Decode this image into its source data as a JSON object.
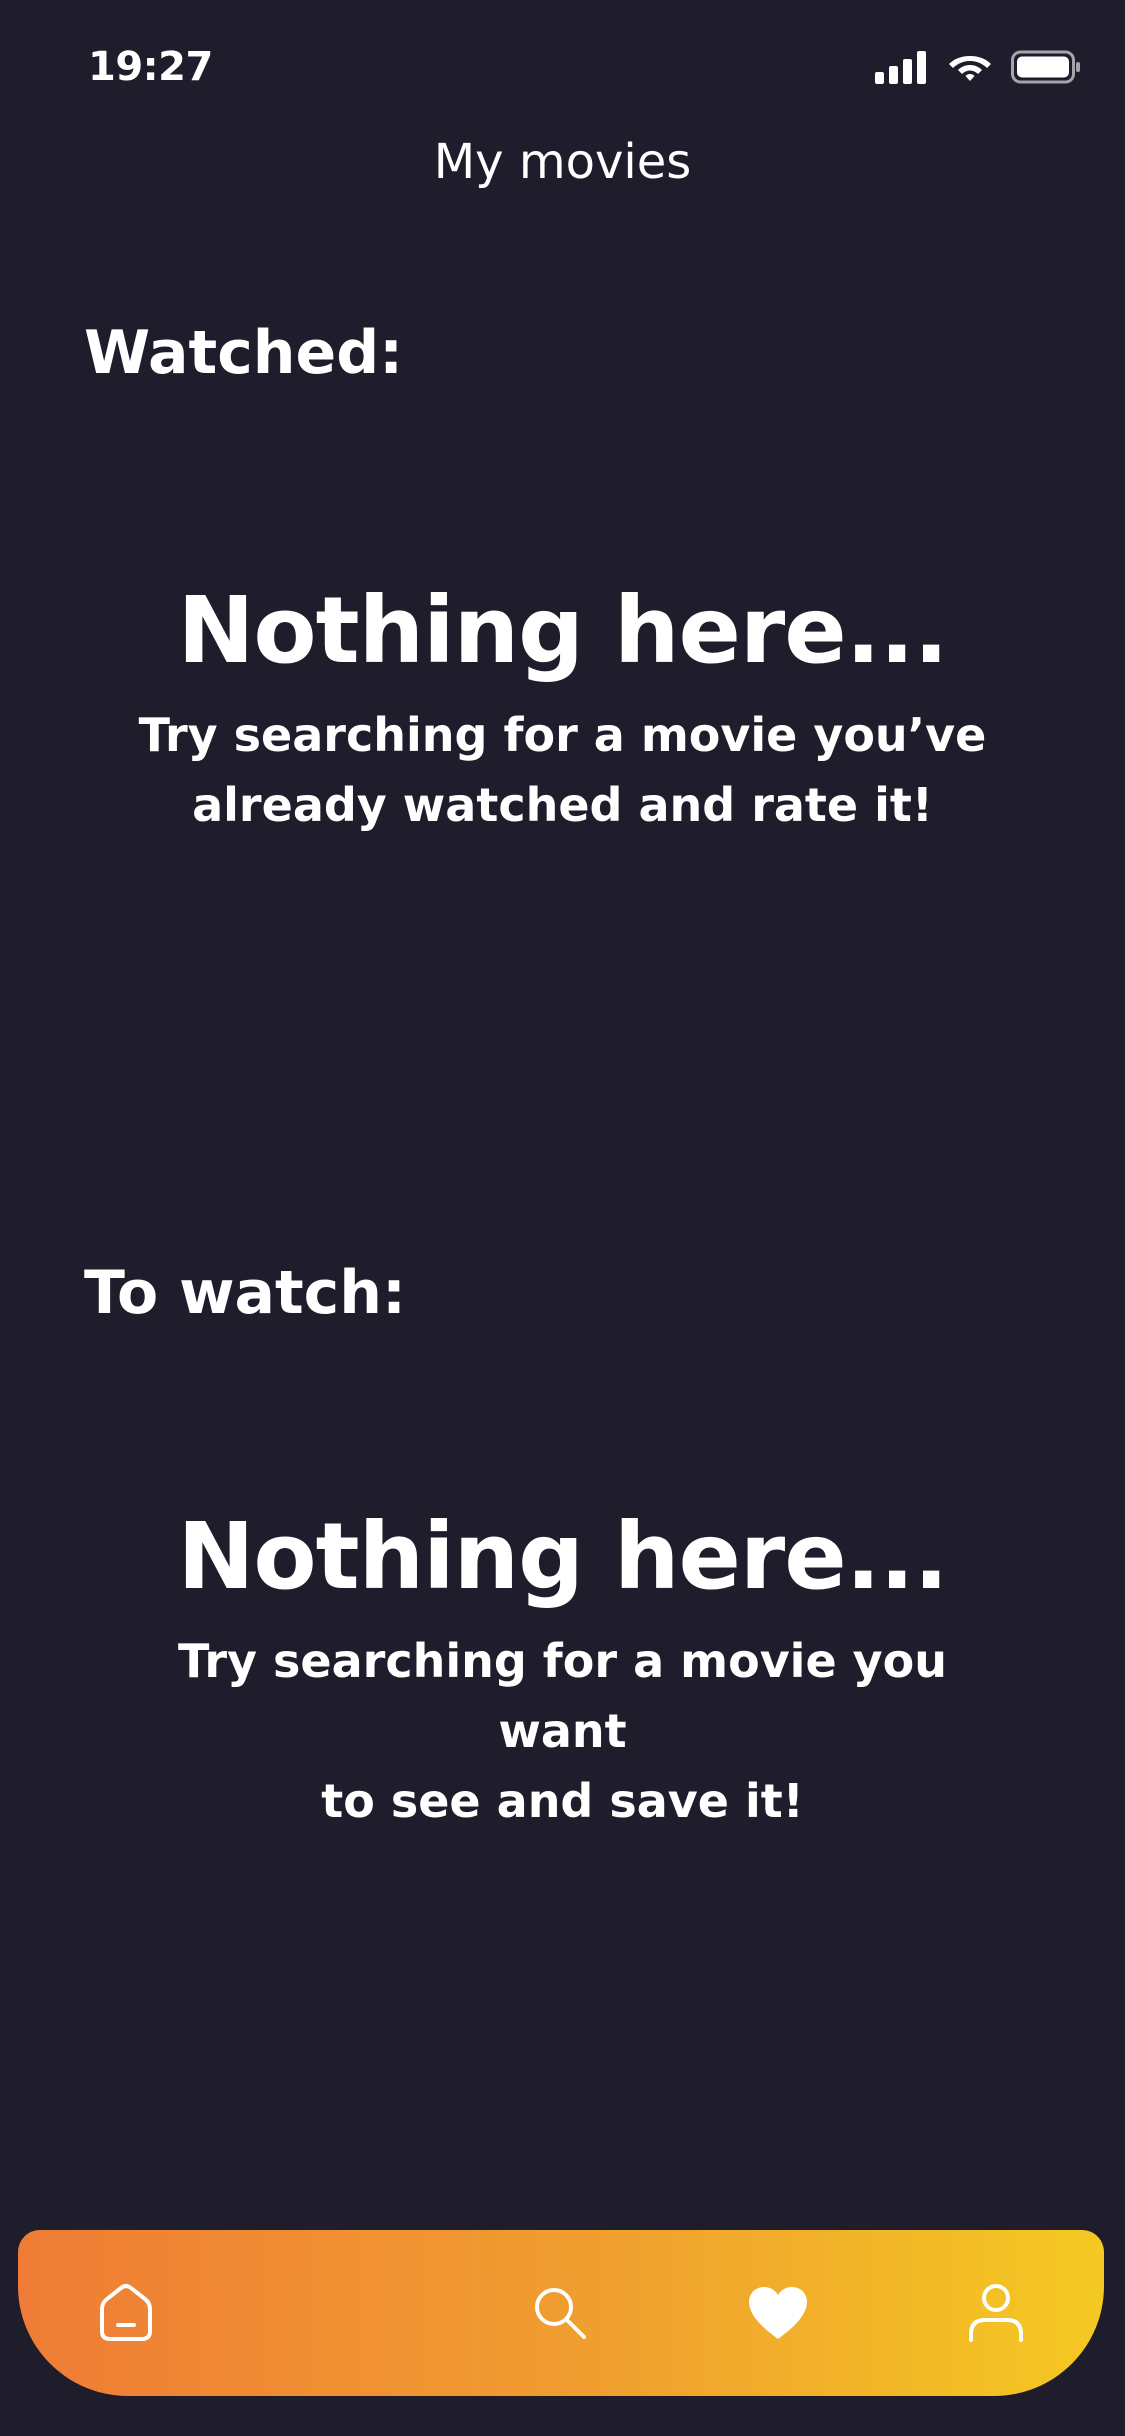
{
  "status_bar": {
    "time": "19:27"
  },
  "header": {
    "title": "My movies"
  },
  "watched": {
    "title": "Watched:",
    "empty_heading": "Nothing here...",
    "empty_text_line1": "Try searching for a movie you’ve",
    "empty_text_line2": "already watched and rate it!"
  },
  "to_watch": {
    "title": "To watch:",
    "empty_heading": "Nothing here...",
    "empty_text_line1": "Try searching for a movie you want",
    "empty_text_line2": "to see and save it!"
  },
  "bottom_nav": {
    "items": [
      {
        "icon": "home-icon",
        "active": false
      },
      {
        "icon": "search-icon",
        "active": false
      },
      {
        "icon": "heart-icon",
        "active": true
      },
      {
        "icon": "user-icon",
        "active": false
      }
    ],
    "gradient_start": "#ef7c36",
    "gradient_end": "#f4c922"
  },
  "colors": {
    "background": "#1f1d2b",
    "text": "#ffffff"
  }
}
